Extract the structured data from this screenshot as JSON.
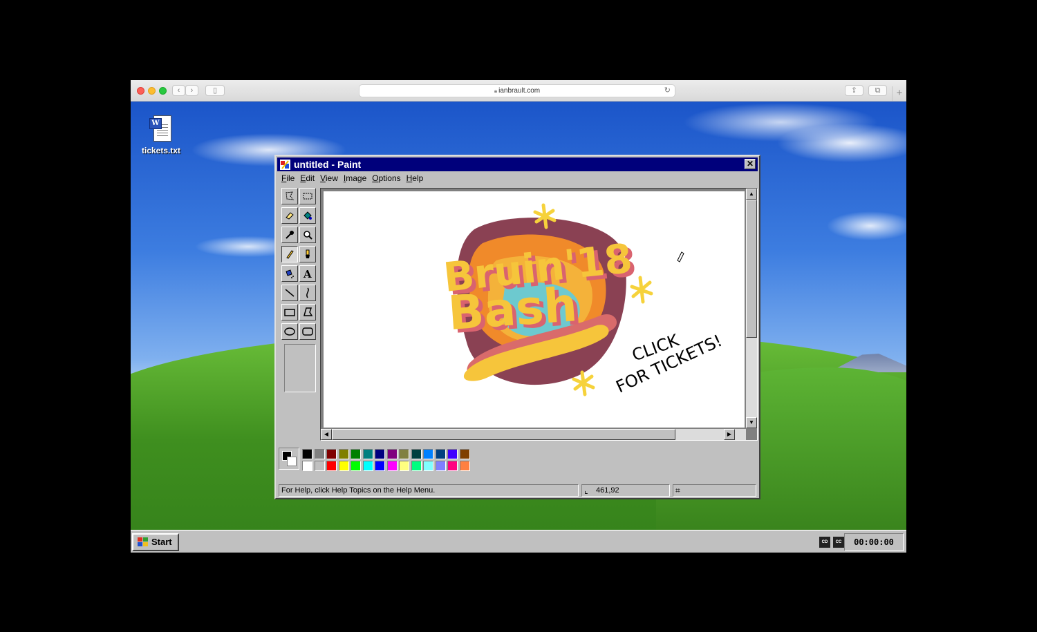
{
  "browser": {
    "url": "ianbrault.com",
    "back_icon": "chevron-left-icon",
    "forward_icon": "chevron-right-icon",
    "sidebar_icon": "sidebar-icon",
    "share_icon": "share-icon",
    "tabs_icon": "tabs-icon",
    "new_tab_label": "+"
  },
  "desktop": {
    "icons": [
      {
        "label": "tickets.txt",
        "icon": "word-document-icon"
      }
    ]
  },
  "paint": {
    "title": "untitled - Paint",
    "close_label": "✕",
    "menu": [
      "File",
      "Edit",
      "View",
      "Image",
      "Options",
      "Help"
    ],
    "canvas_art": {
      "logo_lines": [
        "Bruin'18",
        "Bash"
      ],
      "cta_lines": [
        "CLICK",
        "FOR TICKETS!"
      ]
    },
    "palette_top": [
      "#000000",
      "#808080",
      "#800000",
      "#808000",
      "#008000",
      "#008080",
      "#000080",
      "#800080",
      "#808040",
      "#004040",
      "#0080ff",
      "#004080",
      "#4000ff",
      "#804000"
    ],
    "palette_bottom": [
      "#ffffff",
      "#c0c0c0",
      "#ff0000",
      "#ffff00",
      "#00ff00",
      "#00ffff",
      "#0000ff",
      "#ff00ff",
      "#ffff80",
      "#00ff80",
      "#80ffff",
      "#8080ff",
      "#ff0080",
      "#ff8040"
    ],
    "status": {
      "help_text": "For Help, click Help Topics on the Help Menu.",
      "coords": "461,92"
    }
  },
  "taskbar": {
    "start_label": "Start",
    "clock": "00:00:00",
    "tray_icons": [
      "cd-icon",
      "cc-icon"
    ]
  }
}
